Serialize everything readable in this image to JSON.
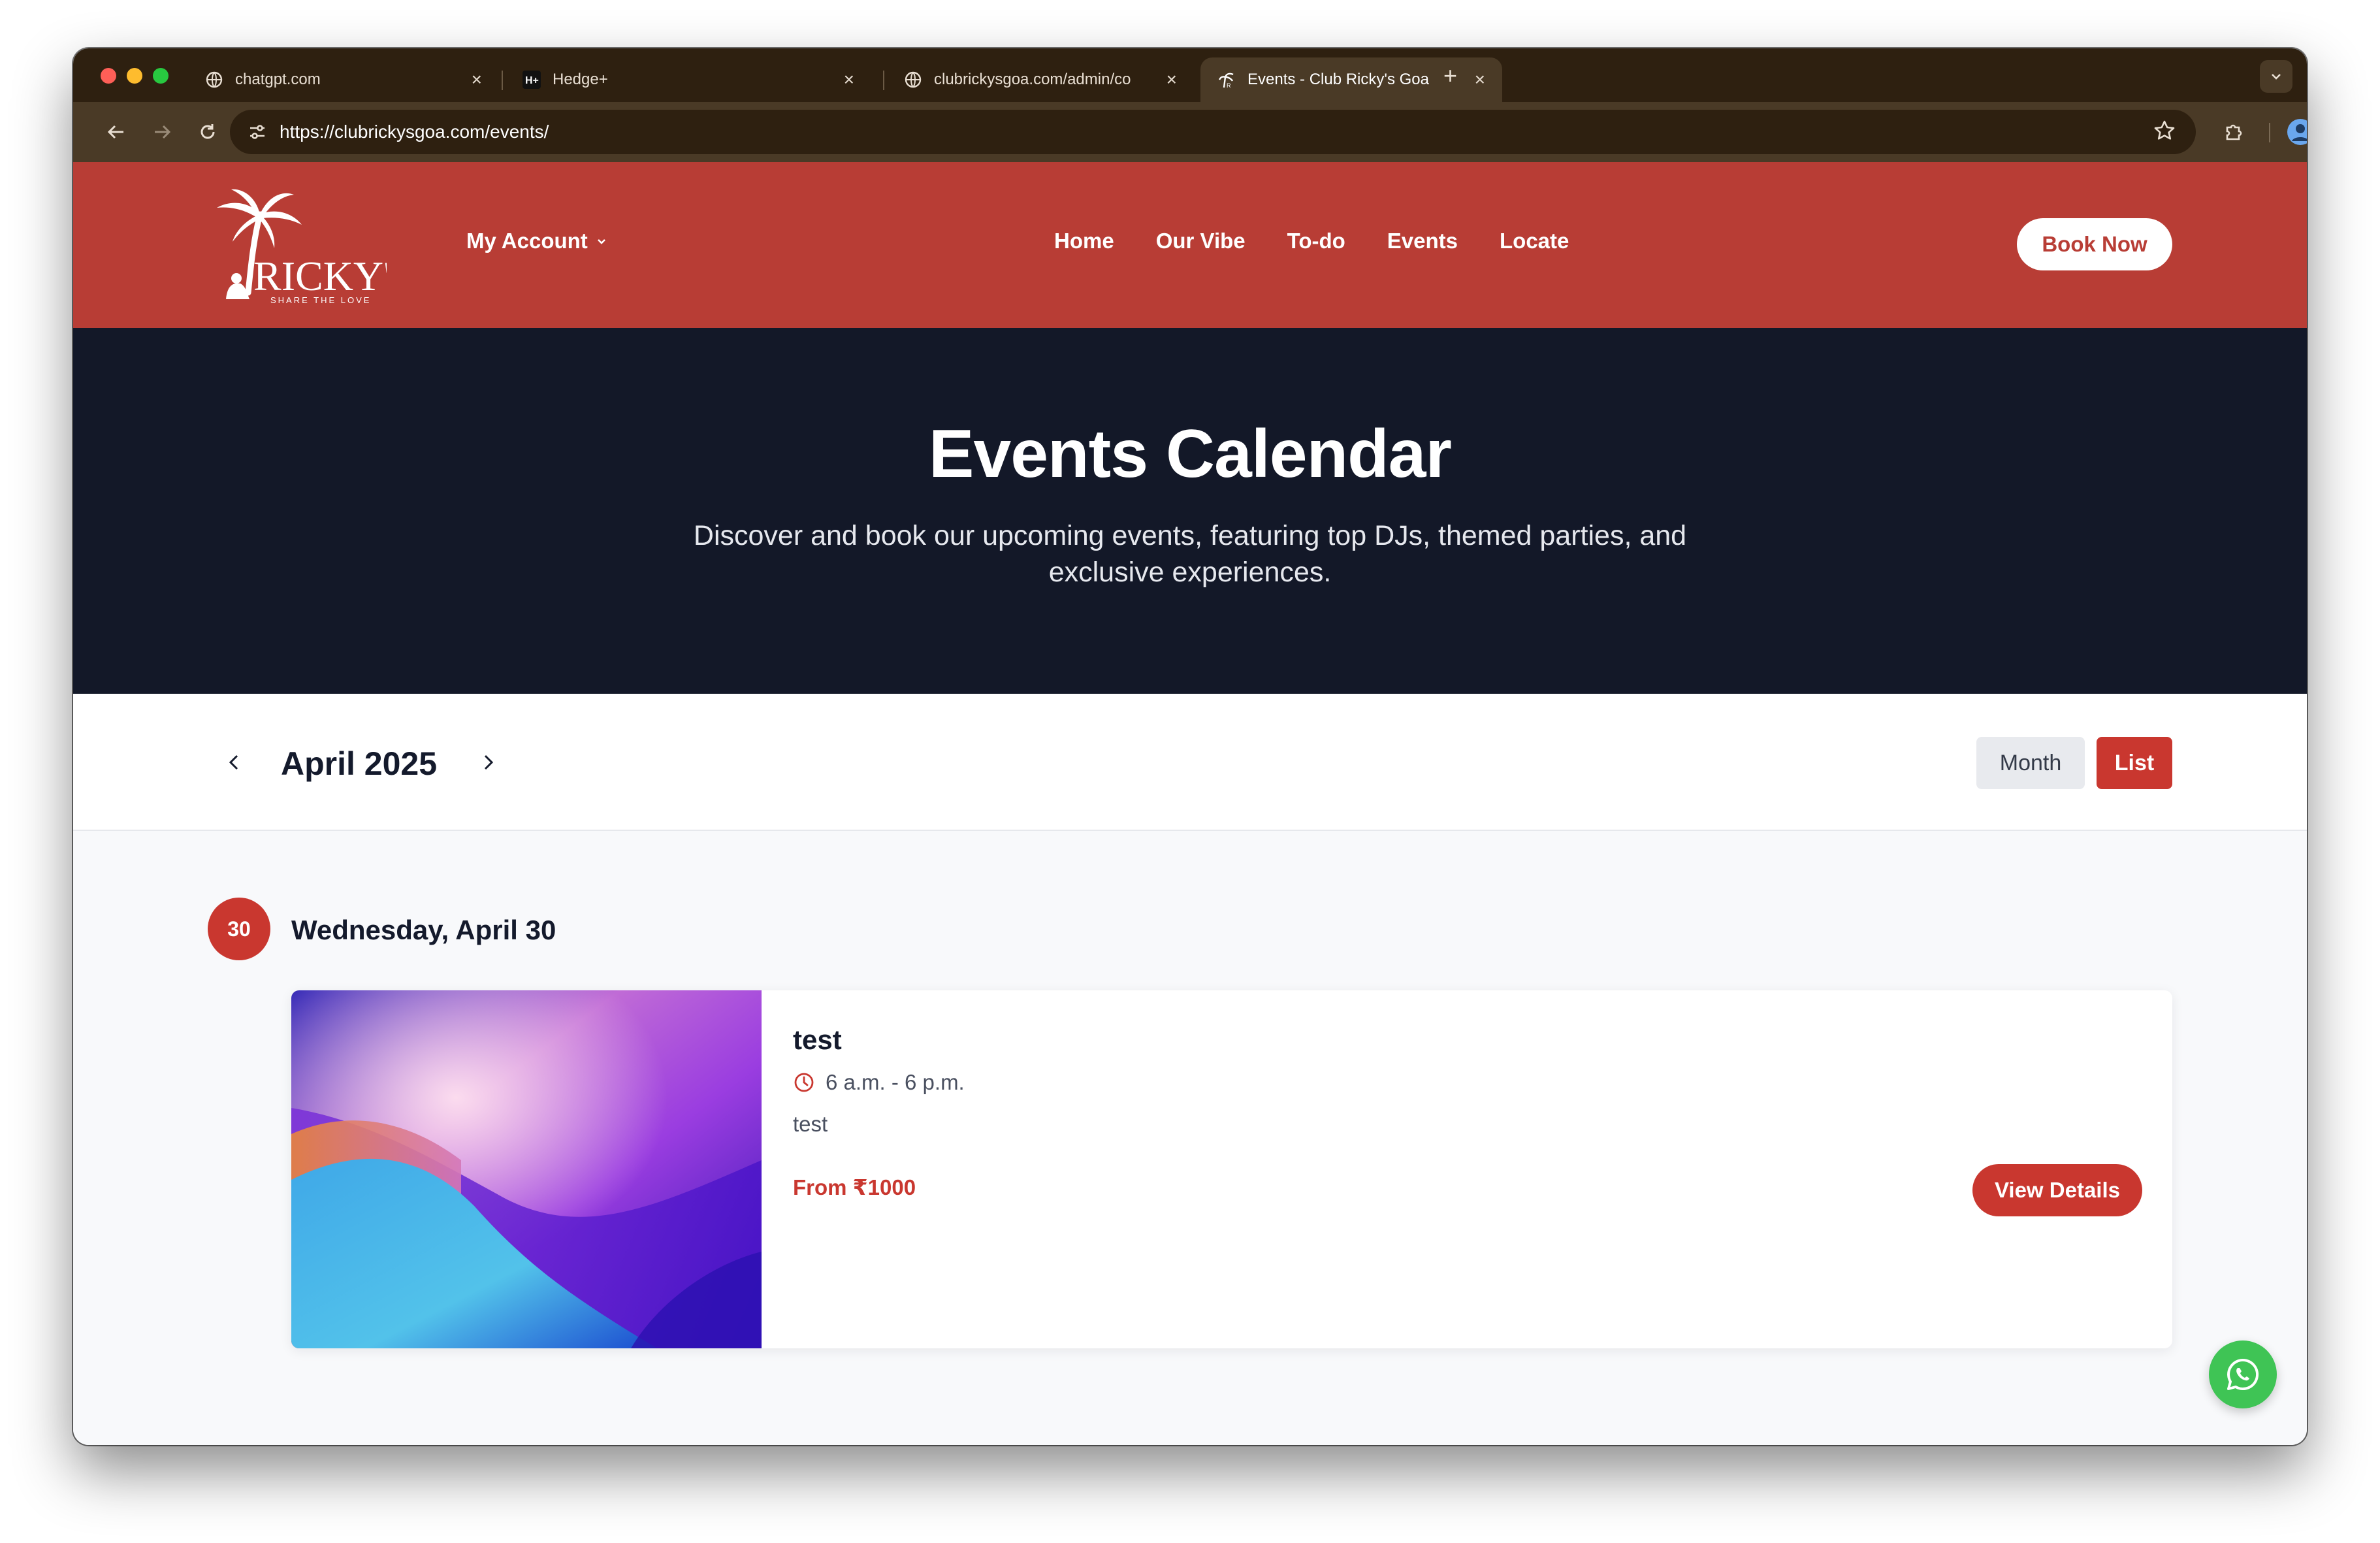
{
  "browser": {
    "tabs": [
      {
        "title": "chatgpt.com",
        "icon": "globe-icon",
        "active": false
      },
      {
        "title": "Hedge+",
        "icon": "hedge-logo-icon",
        "active": false
      },
      {
        "title": "clubrickysgoa.com/admin/co",
        "icon": "globe-icon",
        "active": false
      },
      {
        "title": "Events - Club Ricky's Goa",
        "icon": "rickys-favicon-icon",
        "active": true
      }
    ],
    "url": "https://clubrickysgoa.com/events/"
  },
  "site": {
    "logo": {
      "name": "RICKY'S",
      "tagline": "SHARE THE LOVE"
    },
    "account_menu": "My Account",
    "nav": [
      "Home",
      "Our Vibe",
      "To-do",
      "Events",
      "Locate"
    ],
    "book_now": "Book Now",
    "brand_color": "#b83d35"
  },
  "hero": {
    "title": "Events Calendar",
    "subtitle": "Discover and book our upcoming events, featuring top DJs, themed parties, and exclusive experiences."
  },
  "calendar": {
    "current_month": "April 2025",
    "views": {
      "month": "Month",
      "list": "List"
    },
    "active_view": "List"
  },
  "events_by_day": [
    {
      "day_number": "30",
      "day_label": "Wednesday, April 30",
      "events": [
        {
          "name": "test",
          "time": "6 a.m. - 6 p.m.",
          "description": "test",
          "price": "From ₹1000",
          "cta": "View Details"
        }
      ]
    }
  ]
}
